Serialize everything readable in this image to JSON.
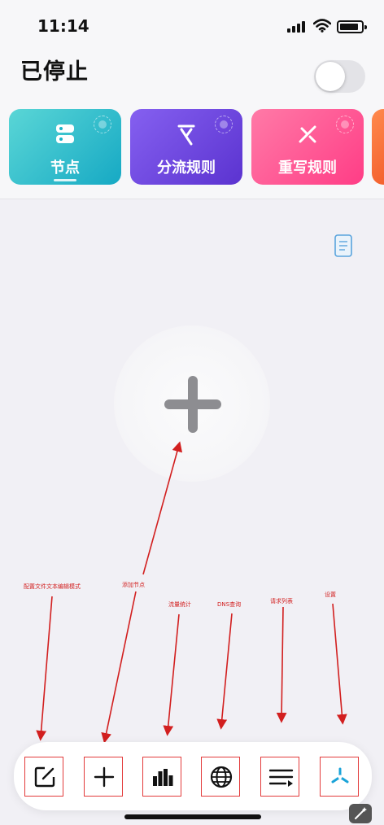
{
  "status_bar": {
    "time": "11:14"
  },
  "header": {
    "title": "已停止",
    "proxy_toggle_on": false
  },
  "feature_cards": [
    {
      "label": "节点",
      "icon": "server-icon",
      "color": "#16a9c4",
      "selected": true
    },
    {
      "label": "分流规则",
      "icon": "split-route-icon",
      "color": "#5b33d0",
      "selected": false
    },
    {
      "label": "重写规则",
      "icon": "rewrite-icon",
      "color": "#ff3d86",
      "selected": false
    }
  ],
  "main": {
    "empty_add_icon": "plus-icon",
    "config_doc_icon": "document-icon"
  },
  "annotations": {
    "config_edit": "配置文件文本编辑模式",
    "add_node": "添加节点",
    "traffic_stats": "流量统计",
    "dns_query": "DNS查询",
    "request_list": "请求列表",
    "settings": "设置"
  },
  "tab_bar": [
    {
      "name": "edit-config",
      "icon": "edit-icon"
    },
    {
      "name": "add-node",
      "icon": "plus-icon"
    },
    {
      "name": "traffic-stats",
      "icon": "bar-chart-icon"
    },
    {
      "name": "dns-query",
      "icon": "globe-icon"
    },
    {
      "name": "request-list",
      "icon": "list-icon"
    },
    {
      "name": "settings",
      "icon": "fan-icon"
    }
  ],
  "colors": {
    "annotation": "#d21f1f",
    "background": "#f1f0f5"
  }
}
